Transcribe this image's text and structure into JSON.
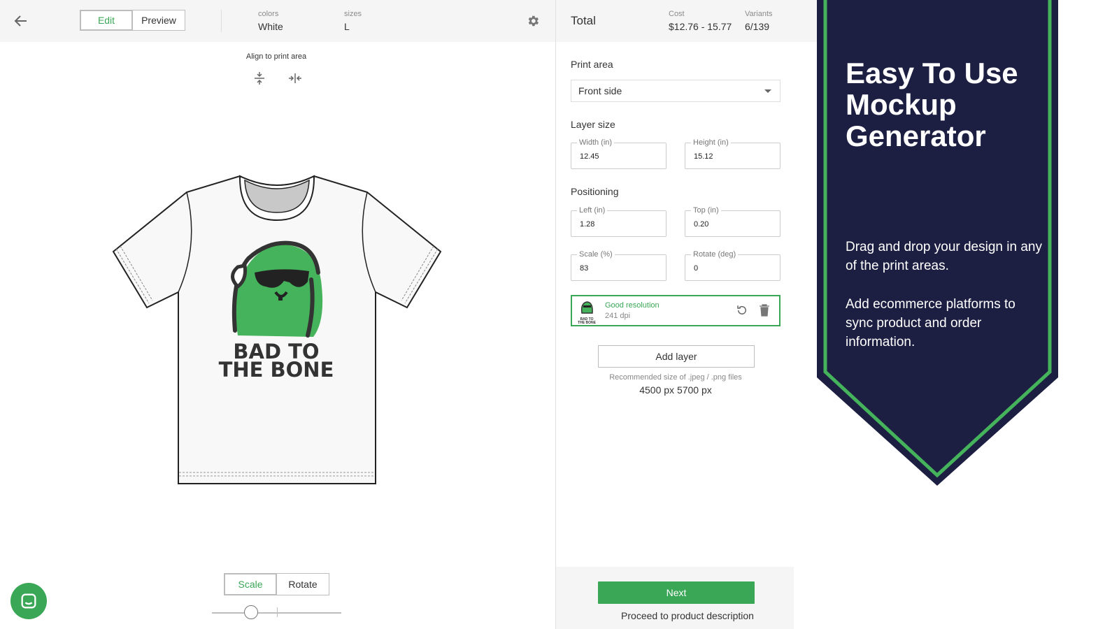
{
  "header": {
    "edit_label": "Edit",
    "preview_label": "Preview",
    "colors_label": "colors",
    "colors_value": "White",
    "sizes_label": "sizes",
    "sizes_value": "L"
  },
  "canvas": {
    "align_title": "Align to print area",
    "design_line1": "BAD TO",
    "design_line2": "THE BONE",
    "shirt_color": "#f8f8f8",
    "design_color": "#45b35b"
  },
  "bottom_tools": {
    "scale_label": "Scale",
    "rotate_label": "Rotate",
    "slider_value_fraction": 0.3
  },
  "summary": {
    "total_label": "Total",
    "cost_label": "Cost",
    "cost_value": "$12.76 - 15.77",
    "variants_label": "Variants",
    "variants_value": "6/139"
  },
  "panel": {
    "print_area_label": "Print area",
    "print_area_value": "Front side",
    "layer_size_label": "Layer size",
    "width_label": "Width (in)",
    "width_value": "12.45",
    "height_label": "Height (in)",
    "height_value": "15.12",
    "positioning_label": "Positioning",
    "left_label": "Left (in)",
    "left_value": "1.28",
    "top_label": "Top (in)",
    "top_value": "0.20",
    "scale_label": "Scale (%)",
    "scale_value": "83",
    "rotate_label": "Rotate (deg)",
    "rotate_value": "0",
    "layer_status": "Good resolution",
    "layer_dpi": "241 dpi",
    "thumb_text_1": "BAD TO",
    "thumb_text_2": "THE BONE",
    "add_layer_label": "Add layer",
    "recommended_label": "Recommended size of .jpeg / .png files",
    "recommended_value": "4500 px 5700 px",
    "next_label": "Next",
    "proceed_label": "Proceed to product description"
  },
  "banner": {
    "title": "Easy To Use Mockup Generator",
    "paragraph1": "Drag and drop your design in any of the print areas.",
    "paragraph2": "Add ecommerce platforms to sync product and order information.",
    "bg_color": "#1d1f42",
    "stripe_color": "#45b35b"
  },
  "colors": {
    "accent": "#3aa757"
  }
}
